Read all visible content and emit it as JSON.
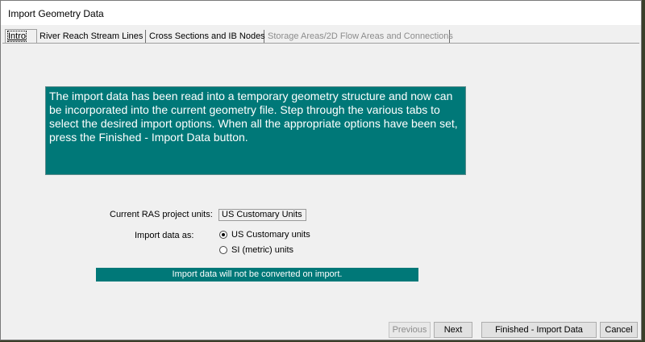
{
  "window": {
    "title": "Import Geometry Data"
  },
  "tabs": [
    {
      "label": "Intro"
    },
    {
      "label": "River Reach Stream Lines"
    },
    {
      "label": "Cross Sections and IB Nodes"
    },
    {
      "label": "Storage Areas/2D Flow Areas and Connections"
    }
  ],
  "intro": {
    "text": "The import data has been read into a temporary geometry structure and now can be incorporated into the current geometry file.  Step through the various tabs to select the desired import options.  When all the appropriate options have been set, press the Finished - Import Data button."
  },
  "units": {
    "current_label": "Current RAS project units:",
    "current_value": "US Customary Units",
    "import_as_label": "Import data as:",
    "options": [
      {
        "label": "US Customary units",
        "selected": true
      },
      {
        "label": "SI (metric) units",
        "selected": false
      }
    ]
  },
  "notice": "Import data will not be converted on import.",
  "buttons": {
    "previous": "Previous",
    "next": "Next",
    "finished": "Finished - Import Data",
    "cancel": "Cancel"
  },
  "colors": {
    "teal": "#007878"
  }
}
